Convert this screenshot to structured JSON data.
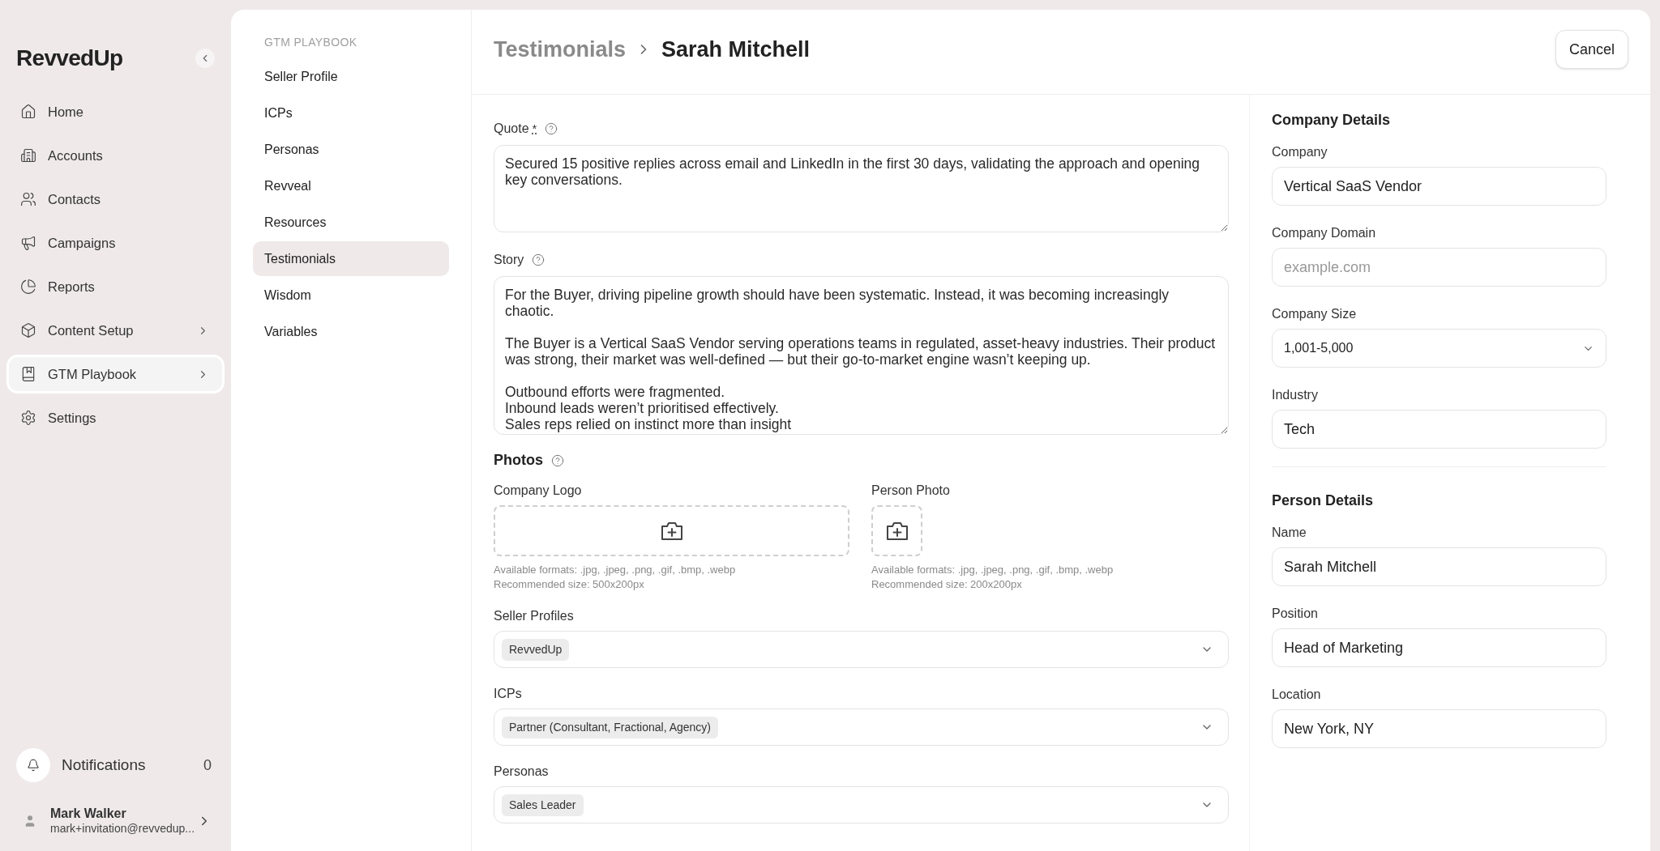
{
  "sidebar": {
    "logo": "RevvedUp",
    "items": [
      {
        "label": "Home",
        "selected": false,
        "has_submenu": false
      },
      {
        "label": "Accounts",
        "selected": false,
        "has_submenu": false
      },
      {
        "label": "Contacts",
        "selected": false,
        "has_submenu": false
      },
      {
        "label": "Campaigns",
        "selected": false,
        "has_submenu": false
      },
      {
        "label": "Reports",
        "selected": false,
        "has_submenu": false
      },
      {
        "label": "Content Setup",
        "selected": false,
        "has_submenu": true
      },
      {
        "label": "GTM Playbook",
        "selected": true,
        "has_submenu": true
      },
      {
        "label": "Settings",
        "selected": false,
        "has_submenu": false
      }
    ],
    "notifications": {
      "label": "Notifications",
      "count": "0"
    },
    "user": {
      "name": "Mark Walker",
      "email": "mark+invitation@revvedup..."
    }
  },
  "subnav": {
    "heading": "GTM PLAYBOOK",
    "items": [
      {
        "label": "Seller Profile",
        "selected": false
      },
      {
        "label": "ICPs",
        "selected": false
      },
      {
        "label": "Personas",
        "selected": false
      },
      {
        "label": "Revveal",
        "selected": false
      },
      {
        "label": "Resources",
        "selected": false
      },
      {
        "label": "Testimonials",
        "selected": true
      },
      {
        "label": "Wisdom",
        "selected": false
      },
      {
        "label": "Variables",
        "selected": false
      }
    ]
  },
  "header": {
    "breadcrumb": "Testimonials",
    "title": "Sarah Mitchell",
    "cancel": "Cancel"
  },
  "form": {
    "quote": {
      "label": "Quote",
      "required_mark": "*",
      "value": "Secured 15 positive replies across email and LinkedIn in the first 30 days, validating the approach and opening key conversations."
    },
    "story": {
      "label": "Story",
      "value": "For the Buyer, driving pipeline growth should have been systematic. Instead, it was becoming increasingly chaotic.\n\nThe Buyer is a Vertical SaaS Vendor serving operations teams in regulated, asset-heavy industries. Their product was strong, their market was well-defined — but their go-to-market engine wasn’t keeping up.\n\nOutbound efforts were fragmented.\nInbound leads weren’t prioritised effectively.\nSales reps relied on instinct more than insight"
    },
    "photos": {
      "heading": "Photos",
      "uploads": [
        {
          "label": "Company Logo",
          "kind": "wide",
          "formats": "Available formats: .jpg, .jpeg, .png, .gif, .bmp, .webp",
          "size": "Recommended size: 500x200px"
        },
        {
          "label": "Person Photo",
          "kind": "square",
          "formats": "Available formats: .jpg, .jpeg, .png, .gif, .bmp, .webp",
          "size": "Recommended size: 200x200px"
        }
      ]
    },
    "selects": [
      {
        "label": "Seller Profiles",
        "chips": [
          "RevvedUp"
        ]
      },
      {
        "label": "ICPs",
        "chips": [
          "Partner (Consultant, Fractional, Agency)"
        ]
      },
      {
        "label": "Personas",
        "chips": [
          "Sales Leader"
        ]
      }
    ]
  },
  "details": [
    {
      "heading": "Company Details",
      "fields": [
        {
          "label": "Company",
          "kind": "text",
          "value": "Vertical SaaS Vendor"
        },
        {
          "label": "Company Domain",
          "kind": "text",
          "placeholder": "example.com"
        },
        {
          "label": "Company Size",
          "kind": "select",
          "value": "1,001-5,000"
        },
        {
          "label": "Industry",
          "kind": "text",
          "value": "Tech"
        }
      ]
    },
    {
      "heading": "Person Details",
      "fields": [
        {
          "label": "Name",
          "kind": "text",
          "value": "Sarah Mitchell"
        },
        {
          "label": "Position",
          "kind": "text",
          "value": "Head of Marketing"
        },
        {
          "label": "Location",
          "kind": "text",
          "value": "New York, NY"
        }
      ]
    }
  ]
}
